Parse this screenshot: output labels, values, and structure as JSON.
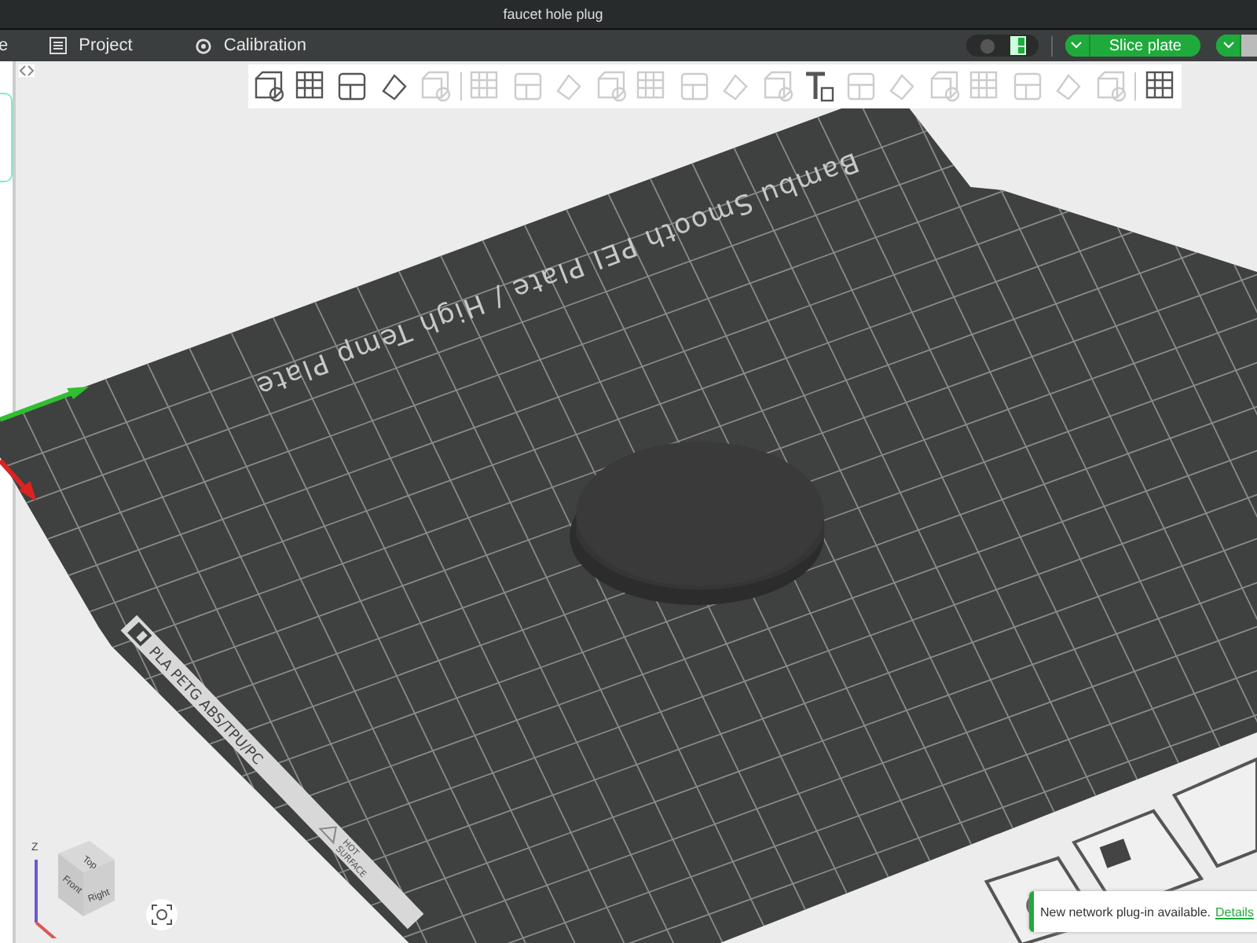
{
  "window": {
    "title": "faucet hole plug"
  },
  "menu_tabs": [
    {
      "label": "e"
    },
    {
      "label": "Project"
    },
    {
      "label": "Calibration"
    }
  ],
  "slice_button": {
    "label": "Slice plate"
  },
  "toolbar": [
    {
      "disabled": false
    },
    {
      "disabled": false
    },
    {
      "disabled": false
    },
    {
      "disabled": false
    },
    {
      "disabled": true
    },
    {
      "disabled": true
    },
    {
      "disabled": true
    },
    {
      "disabled": true
    },
    {
      "disabled": true
    },
    {
      "disabled": true
    },
    {
      "disabled": true
    },
    {
      "disabled": true
    },
    {
      "disabled": true
    },
    {
      "disabled": false
    },
    {
      "disabled": true
    },
    {
      "disabled": true
    },
    {
      "disabled": true
    },
    {
      "disabled": true
    },
    {
      "disabled": true
    },
    {
      "disabled": true
    },
    {
      "disabled": true
    },
    {
      "disabled": false
    }
  ],
  "plate": {
    "name": "Bambu Smooth PEI Plate / High Temp Plate",
    "materials": "PLA PETG ABS/TPU/PC",
    "warning": [
      "HOT",
      "SURFACE"
    ]
  },
  "view_cube": {
    "faces": [
      "Top",
      "Front",
      "Right"
    ],
    "axis": "Z"
  },
  "notification": {
    "message": "New network plug-in available.",
    "link": "Details"
  }
}
